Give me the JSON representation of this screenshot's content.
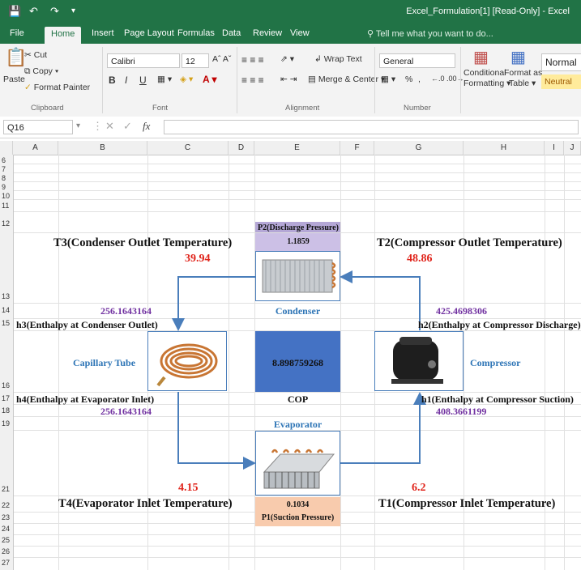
{
  "window": {
    "title": "Excel_Formulation[1]  [Read-Only]  -  Excel"
  },
  "tabs": [
    "File",
    "Home",
    "Insert",
    "Page Layout",
    "Formulas",
    "Data",
    "Review",
    "View"
  ],
  "tell_me": "Tell me what you want to do...",
  "ribbon": {
    "paste": "Paste",
    "cut": "Cut",
    "copy": "Copy",
    "format_painter": "Format Painter",
    "font_name": "Calibri",
    "font_size": "12",
    "bold": "B",
    "italic": "I",
    "underline": "U",
    "wrap_text": "Wrap Text",
    "merge_center": "Merge & Center",
    "number_format": "General",
    "percent": "%",
    "comma": ",",
    "conditional_1": "Conditional",
    "conditional_2": "Formatting",
    "format_as_1": "Format as",
    "format_as_2": "Table",
    "style_normal": "Normal",
    "style_neutral": "Neutral",
    "groups": {
      "clipboard": "Clipboard",
      "font": "Font",
      "alignment": "Alignment",
      "number": "Number"
    }
  },
  "formula_bar": {
    "name_box": "Q16",
    "fx": "fx",
    "value": ""
  },
  "columns": [
    "A",
    "B",
    "C",
    "D",
    "E",
    "F",
    "G",
    "H",
    "I",
    "J"
  ],
  "rows": [
    "6",
    "7",
    "8",
    "9",
    "10",
    "11",
    "12",
    "13",
    "14",
    "15",
    "16",
    "17",
    "18",
    "19",
    "21",
    "22",
    "23",
    "24",
    "25",
    "26",
    "27"
  ],
  "sheet": {
    "t3_label": "T3(Condenser Outlet Temperature)",
    "t2_label": "T2(Compressor Outlet Temperature)",
    "t4_label": "T4(Evaporator Inlet Temperature)",
    "t1_label": "T1(Compressor Inlet Temperature)",
    "t3_value": "39.94",
    "t2_value": "48.86",
    "t4_value": "4.15",
    "t1_value": "6.2",
    "p2_label": "P2(Discharge Pressure)",
    "p2_value": "1.1859",
    "p1_value": "0.1034",
    "p1_label": "P1(Suction Pressure)",
    "h3_value": "256.1643164",
    "h3_label": "h3(Enthalpy at Condenser Outlet)",
    "h2_value": "425.4698306",
    "h2_label": "h2(Enthalpy at Compressor Discharge)",
    "h4_label": "h4(Enthalpy at Evaporator Inlet)",
    "h4_value": "256.1643164",
    "h1_label": "h1(Enthalpy at Compressor Suction)",
    "h1_value": "408.3661199",
    "condenser": "Condenser",
    "evaporator": "Evaporator",
    "capillary": "Capillary Tube",
    "compressor": "Compressor",
    "cop_value": "8.898759268",
    "cop_label": "COP"
  },
  "colors": {
    "excel_green": "#217346",
    "p2_fill": "#b4a7d6",
    "cop_fill": "#4472c4",
    "p1_fill": "#f8cbad",
    "arrow": "#4a7ebb"
  }
}
